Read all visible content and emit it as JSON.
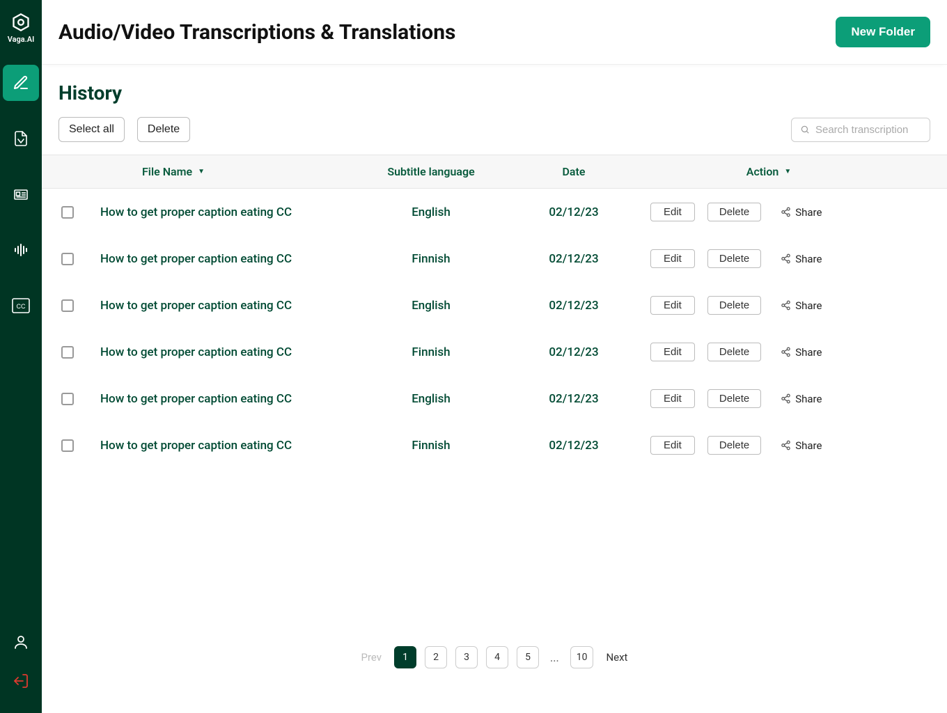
{
  "brand": "Vaga.AI",
  "header": {
    "title": "Audio/Video Transcriptions & Translations",
    "new_folder": "New Folder"
  },
  "history": {
    "title": "History",
    "select_all": "Select all",
    "delete": "Delete",
    "search_placeholder": "Search transcription"
  },
  "columns": {
    "filename": "File Name",
    "language": "Subtitle language",
    "date": "Date",
    "action": "Action"
  },
  "row_actions": {
    "edit": "Edit",
    "delete": "Delete",
    "share": "Share"
  },
  "rows": [
    {
      "name": "How to get proper caption eating CC",
      "lang": "English",
      "date": "02/12/23"
    },
    {
      "name": "How to get proper caption eating CC",
      "lang": "Finnish",
      "date": "02/12/23"
    },
    {
      "name": "How to get proper caption eating CC",
      "lang": "English",
      "date": "02/12/23"
    },
    {
      "name": "How to get proper caption eating CC",
      "lang": "Finnish",
      "date": "02/12/23"
    },
    {
      "name": "How to get proper caption eating CC",
      "lang": "English",
      "date": "02/12/23"
    },
    {
      "name": "How to get proper caption eating CC",
      "lang": "Finnish",
      "date": "02/12/23"
    }
  ],
  "pagination": {
    "prev": "Prev",
    "next": "Next",
    "pages": [
      "1",
      "2",
      "3",
      "4",
      "5"
    ],
    "ellipsis": "...",
    "last": "10",
    "active": "1"
  }
}
